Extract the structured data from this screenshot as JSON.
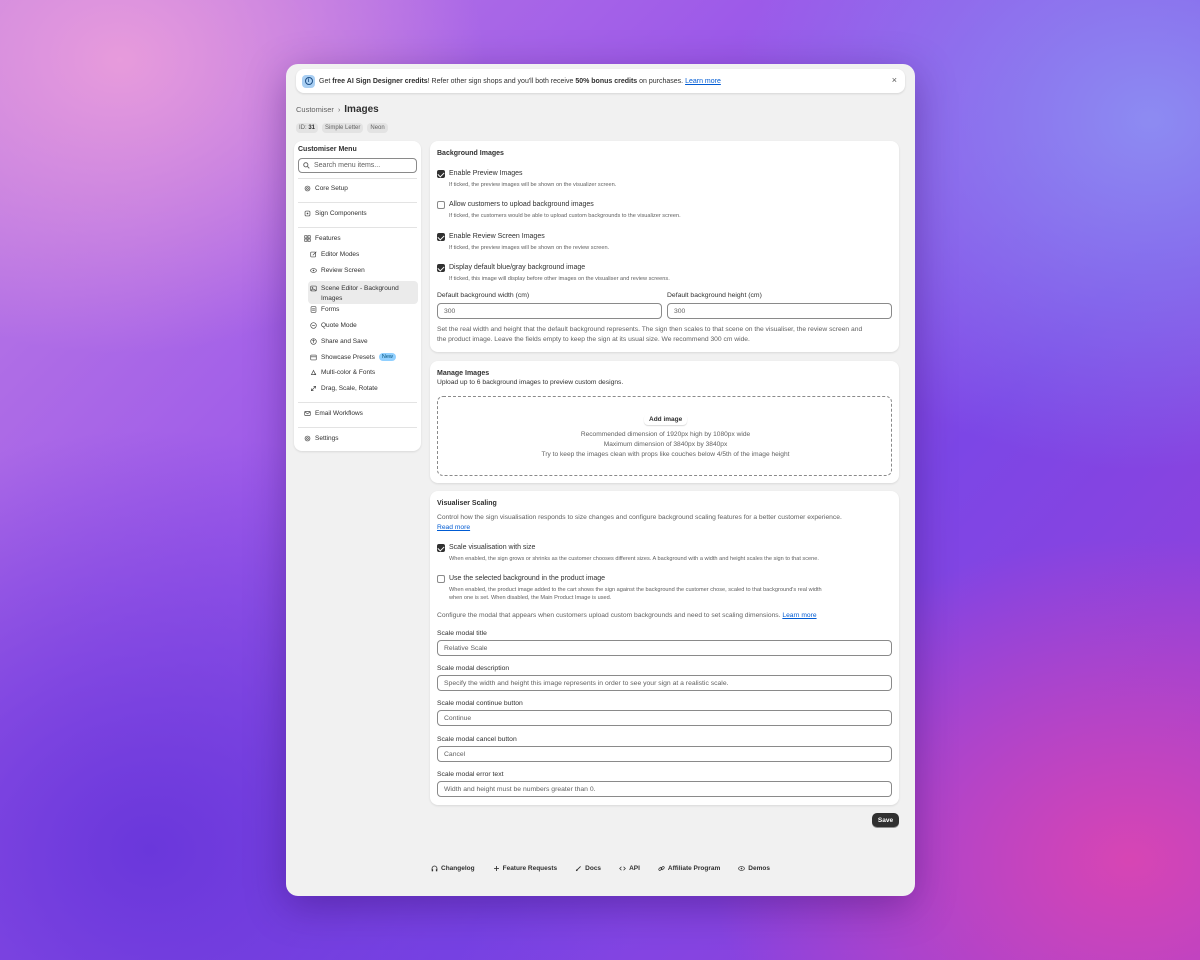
{
  "banner": {
    "text_1": "Get ",
    "bold_1": "free AI Sign Designer credits",
    "text_2": "! Refer other sign shops and you'll both receive ",
    "bold_2": "50% bonus credits",
    "text_3": " on purchases. ",
    "link": "Learn more",
    "close": "×",
    "info_glyph": "i"
  },
  "breadcrumb": {
    "parent": "Customiser",
    "separator": "›",
    "current": "Images"
  },
  "tags": {
    "id_label": "ID:",
    "id_value": "31",
    "tag1": "Simple Letter",
    "tag2": "Neon"
  },
  "sidebar": {
    "title": "Customiser Menu",
    "search_placeholder": "Search menu items...",
    "items": [
      {
        "label": "Core Setup",
        "icon": "gear-icon"
      },
      {
        "label": "Sign Components",
        "icon": "puzzle-icon"
      },
      {
        "label": "Features",
        "icon": "grid-icon"
      },
      {
        "label": "Editor Modes",
        "icon": "edit-icon"
      },
      {
        "label": "Review Screen",
        "icon": "eye-icon"
      },
      {
        "label": "Scene Editor - Background Images",
        "icon": "image-icon"
      },
      {
        "label": "Forms",
        "icon": "form-icon"
      },
      {
        "label": "Quote Mode",
        "icon": "quote-icon"
      },
      {
        "label": "Share and Save",
        "icon": "share-icon"
      },
      {
        "label": "Showcase Presets",
        "icon": "preset-icon",
        "badge": "New"
      },
      {
        "label": "Multi-color & Fonts",
        "icon": "palette-icon"
      },
      {
        "label": "Drag, Scale, Rotate",
        "icon": "resize-icon"
      },
      {
        "label": "Email Workflows",
        "icon": "email-icon"
      },
      {
        "label": "Settings",
        "icon": "gear-icon"
      }
    ]
  },
  "background_images": {
    "title": "Background Images",
    "options": [
      {
        "label": "Enable Preview Images",
        "checked": true,
        "help": "If ticked, the preview images will be shown on the visualizer screen."
      },
      {
        "label": "Allow customers to upload background images",
        "checked": false,
        "help": "If ticked, the customers would be able to upload custom backgrounds to the visualizer screen."
      },
      {
        "label": "Enable Review Screen Images",
        "checked": true,
        "help": "If ticked, the preview images will be shown on the review screen."
      },
      {
        "label": "Display default blue/gray background image",
        "checked": true,
        "help": "If ticked, this image will display before other images on the visualiser and review screens."
      }
    ],
    "width_label": "Default background width (cm)",
    "width_value": "300",
    "height_label": "Default background height (cm)",
    "height_value": "300",
    "description_1": "Set the real width and height that the default background represents. The sign then scales to that scene on the visualiser, the review screen and",
    "description_2": "the product image. Leave the fields empty to keep the sign at its usual size. We recommend 300 cm wide."
  },
  "manage_images": {
    "title": "Manage Images",
    "subtitle": "Upload up to 6 background images to preview custom designs.",
    "add_button": "Add image",
    "line_1": "Recommended dimension of 1920px high by 1080px wide",
    "line_2": "Maximum dimension of 3840px by 3840px",
    "line_3": "Try to keep the images clean with props like couches below 4/5th of the image height"
  },
  "visualiser_scaling": {
    "title": "Visualiser Scaling",
    "intro": "Control how the sign visualisation responds to size changes and configure background scaling features for a better customer experience.",
    "read_more": "Read more",
    "options": [
      {
        "label": "Scale visualisation with size",
        "checked": true,
        "help": "When enabled, the sign grows or shrinks as the customer chooses different sizes. A background with a width and height scales the sign to that scene."
      },
      {
        "label": "Use the selected background in the product image",
        "checked": false,
        "help_1": "When enabled, the product image added to the cart shows the sign against the background the customer chose, scaled to that background's real width",
        "help_2": "when one is set. When disabled, the Main Product Image is used."
      }
    ],
    "configure_text": "Configure the modal that appears when customers upload custom backgrounds and need to set scaling dimensions. ",
    "learn_more": "Learn more",
    "fields": [
      {
        "label": "Scale modal title",
        "placeholder": "Relative Scale"
      },
      {
        "label": "Scale modal description",
        "placeholder": "Specify the width and height this image represents in order to see your sign at a realistic scale."
      },
      {
        "label": "Scale modal continue button",
        "placeholder": "Continue"
      },
      {
        "label": "Scale modal cancel button",
        "placeholder": "Cancel"
      },
      {
        "label": "Scale modal error text",
        "placeholder": "Width and height must be numbers greater than 0."
      }
    ]
  },
  "save_button": "Save",
  "footer": {
    "links": [
      {
        "label": "Changelog",
        "icon": "headset-icon"
      },
      {
        "label": "Feature Requests",
        "icon": "plus-icon"
      },
      {
        "label": "Docs",
        "icon": "docs-icon"
      },
      {
        "label": "API",
        "icon": "code-icon"
      },
      {
        "label": "Affiliate Program",
        "icon": "link-icon"
      },
      {
        "label": "Demos",
        "icon": "eye-icon"
      }
    ]
  },
  "colors": {
    "accent_link": "#005bd3",
    "button_dark": "#303030",
    "badge_new_bg": "#91d0ff"
  }
}
